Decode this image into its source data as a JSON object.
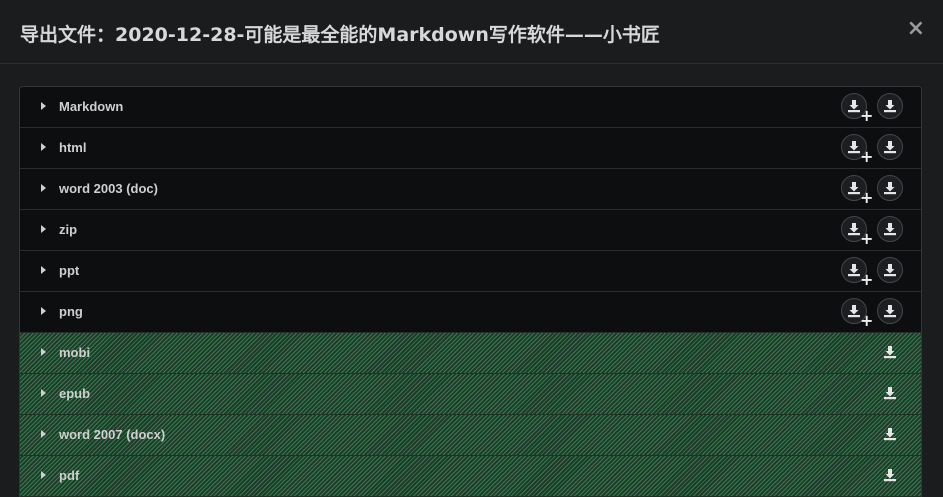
{
  "dialog": {
    "title": "导出文件：2020-12-28-可能是最全能的Markdown写作软件——小书匠",
    "close_label": "×"
  },
  "formats": [
    {
      "label": "Markdown",
      "style": "normal"
    },
    {
      "label": "html",
      "style": "normal"
    },
    {
      "label": "word 2003 (doc)",
      "style": "normal"
    },
    {
      "label": "zip",
      "style": "normal"
    },
    {
      "label": "ppt",
      "style": "normal"
    },
    {
      "label": "png",
      "style": "normal"
    },
    {
      "label": "mobi",
      "style": "premium"
    },
    {
      "label": "epub",
      "style": "premium"
    },
    {
      "label": "word 2007 (docx)",
      "style": "premium"
    },
    {
      "label": "pdf",
      "style": "premium"
    }
  ],
  "icons": {
    "expand": "caret-right-icon",
    "download": "download-icon",
    "download_add": "download-plus-icon",
    "plus_glyph": "+"
  },
  "colors": {
    "background": "#1b1c1e",
    "list_background": "#0d0e10",
    "premium_stripe": "#50aa6e",
    "text": "#cfcfcf"
  }
}
